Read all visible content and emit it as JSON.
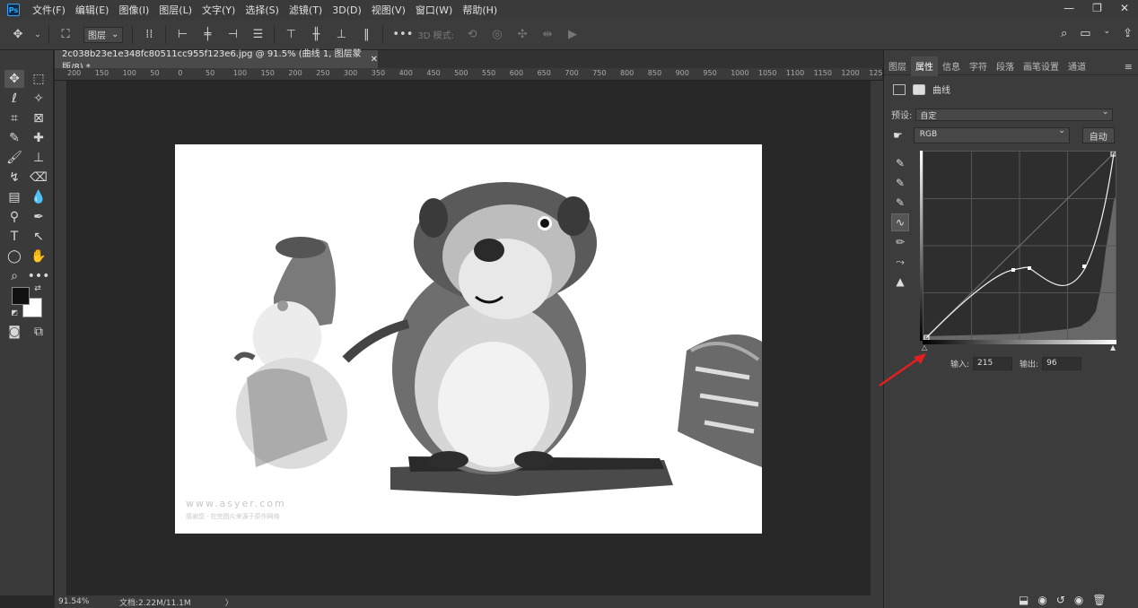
{
  "menubar": {
    "logo": "Ps",
    "items": [
      "文件(F)",
      "编辑(E)",
      "图像(I)",
      "图层(L)",
      "文字(Y)",
      "选择(S)",
      "滤镜(T)",
      "3D(D)",
      "视图(V)",
      "窗口(W)",
      "帮助(H)"
    ],
    "window_controls": [
      "—",
      "❐",
      "✕"
    ]
  },
  "optionsbar": {
    "layer_select": "图层",
    "mode_3d_label": "3D 模式:"
  },
  "document": {
    "tab_title": "2c038b23e1e348fc80511cc955f123e6.jpg @ 91.5% (曲线 1, 图层蒙版/8) *",
    "close_glyph": "✕",
    "ruler_marks": [
      "200",
      "150",
      "100",
      "50",
      "0",
      "50",
      "100",
      "150",
      "200",
      "250",
      "300",
      "350",
      "400",
      "450",
      "500",
      "550",
      "600",
      "650",
      "700",
      "750",
      "800",
      "850",
      "900",
      "950",
      "1000",
      "1050",
      "1100",
      "1150",
      "1200",
      "1250"
    ],
    "watermark": "www.asyer.com",
    "watermark_sub": "感谢您 · 在完图片来源于原作网络"
  },
  "statusbar": {
    "zoom": "91.54%",
    "doc_size": "文档:2.22M/11.1M",
    "arrow": "〉"
  },
  "panel": {
    "tabs": [
      "图层",
      "属性",
      "信息",
      "字符",
      "段落",
      "画笔设置",
      "通道"
    ],
    "active_tab": "属性",
    "header": "曲线",
    "preset_label": "预设:",
    "preset_value": "自定",
    "channel_value": "RGB",
    "auto_button": "自动",
    "input_label": "输入:",
    "input_value": "215",
    "output_label": "输出:",
    "output_value": "96"
  },
  "colors": {
    "accent_red": "#e02020",
    "foreground": "#111111",
    "background": "#ffffff"
  }
}
